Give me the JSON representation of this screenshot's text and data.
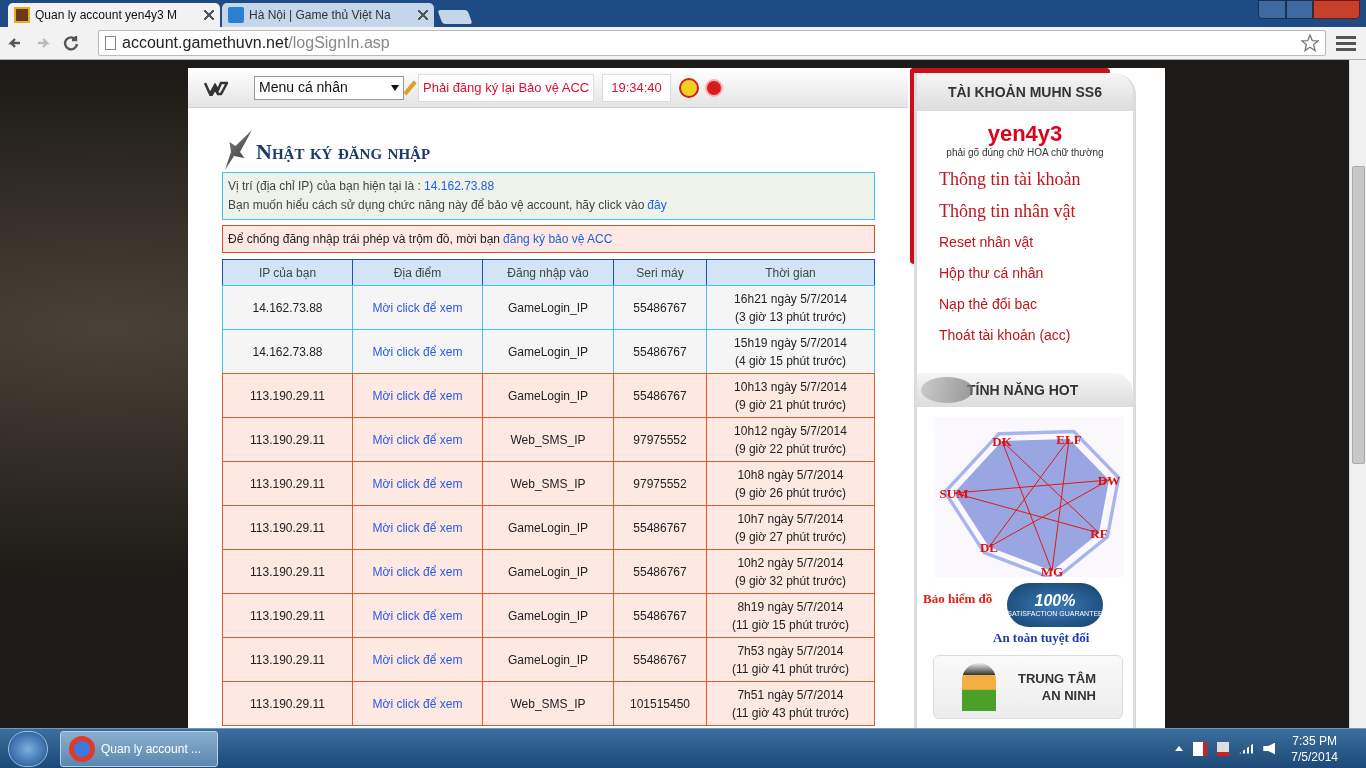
{
  "browser": {
    "tabs": [
      {
        "title": "Quan ly account yen4y3 M",
        "selected": true
      },
      {
        "title": "Hà Nội | Game thủ Việt Na",
        "selected": false
      }
    ],
    "url_host": "account.gamethuvn.net",
    "url_path": "/logSignIn.asp"
  },
  "topbar": {
    "menu_select": "Menu cá nhân",
    "notice": "Phải đăng ký lại Bảo vệ ACC",
    "clock": "19:34:40"
  },
  "main": {
    "title": "Nhật ký đăng nhập",
    "ip_info": {
      "line1": "Vị trí (địa chỉ IP) của bạn hiện tại là : ",
      "ip": "14.162.73.88",
      "line2": "Bạn muốn hiểu cách sử dụng chức năng này để bảo vệ account, hãy click vào ",
      "link": "đây"
    },
    "warning": {
      "text": "Để chống đăng nhập trái phép và trộm đồ, mời bạn ",
      "link": "đăng ký bảo vệ ACC"
    },
    "table": {
      "columns": [
        "IP của bạn",
        "Địa điểm",
        "Đăng nhập vào",
        "Seri máy",
        "Thời gian"
      ],
      "rows": [
        {
          "kind": "current",
          "ip": "14.162.73.88",
          "location": "Mời click để xem",
          "login_to": "GameLogin_IP",
          "serial": "55486767",
          "time": "16h21 ngày 5/7/2014",
          "ago": "(3 giờ 13 phút trước)"
        },
        {
          "kind": "current",
          "ip": "14.162.73.88",
          "location": "Mời click để xem",
          "login_to": "GameLogin_IP",
          "serial": "55486767",
          "time": "15h19 ngày 5/7/2014",
          "ago": "(4 giờ 15 phút trước)"
        },
        {
          "kind": "other",
          "ip": "113.190.29.11",
          "location": "Mời click để xem",
          "login_to": "GameLogin_IP",
          "serial": "55486767",
          "time": "10h13 ngày 5/7/2014",
          "ago": "(9 giờ 21 phút trước)"
        },
        {
          "kind": "other",
          "ip": "113.190.29.11",
          "location": "Mời click để xem",
          "login_to": "Web_SMS_IP",
          "serial": "97975552",
          "time": "10h12 ngày 5/7/2014",
          "ago": "(9 giờ 22 phút trước)"
        },
        {
          "kind": "other",
          "ip": "113.190.29.11",
          "location": "Mời click để xem",
          "login_to": "Web_SMS_IP",
          "serial": "97975552",
          "time": "10h8 ngày 5/7/2014",
          "ago": "(9 giờ 26 phút trước)"
        },
        {
          "kind": "other",
          "ip": "113.190.29.11",
          "location": "Mời click để xem",
          "login_to": "GameLogin_IP",
          "serial": "55486767",
          "time": "10h7 ngày 5/7/2014",
          "ago": "(9 giờ 27 phút trước)"
        },
        {
          "kind": "other",
          "ip": "113.190.29.11",
          "location": "Mời click để xem",
          "login_to": "GameLogin_IP",
          "serial": "55486767",
          "time": "10h2 ngày 5/7/2014",
          "ago": "(9 giờ 32 phút trước)"
        },
        {
          "kind": "other",
          "ip": "113.190.29.11",
          "location": "Mời click để xem",
          "login_to": "GameLogin_IP",
          "serial": "55486767",
          "time": "8h19 ngày 5/7/2014",
          "ago": "(11 giờ 15 phút trước)"
        },
        {
          "kind": "other",
          "ip": "113.190.29.11",
          "location": "Mời click để xem",
          "login_to": "GameLogin_IP",
          "serial": "55486767",
          "time": "7h53 ngày 5/7/2014",
          "ago": "(11 giờ 41 phút trước)"
        },
        {
          "kind": "other",
          "ip": "113.190.29.11",
          "location": "Mời click để xem",
          "login_to": "Web_SMS_IP",
          "serial": "101515450",
          "time": "7h51 ngày 5/7/2014",
          "ago": "(11 giờ 43 phút trước)"
        }
      ]
    }
  },
  "sidebar": {
    "account_title": "TÀI KHOẢN MUHN SS6",
    "username": "yen4y3",
    "username_hint": "phải gõ đúng chữ HOA chữ thường",
    "links": [
      {
        "label": "Thông tin tài khoản",
        "kind": "large"
      },
      {
        "label": "Thông tin nhân vật",
        "kind": "large"
      },
      {
        "label": "Reset nhân vật",
        "kind": "small"
      },
      {
        "label": "Hộp thư cá nhân",
        "kind": "small"
      },
      {
        "label": "Nạp thẻ đổi bạc",
        "kind": "small"
      },
      {
        "label": "Thoát tài khoản (acc)",
        "kind": "small"
      }
    ],
    "hot_title": "TÍNH NĂNG HOT",
    "class_wheel_labels": [
      "DK",
      "ELF",
      "DW",
      "RF",
      "MG",
      "DL",
      "SUM"
    ],
    "insurance_banner": {
      "title": "Bảo hiểm đồ",
      "badge": "100%",
      "badge_caption": "SATISFACTION GUARANTEE",
      "tagline": "An toàn tuyệt đối"
    },
    "security_center": [
      "TRUNG TÂM",
      "AN NINH"
    ]
  },
  "taskbar": {
    "task": "Quan ly account ...",
    "time": "7:35 PM",
    "date": "7/5/2014"
  }
}
